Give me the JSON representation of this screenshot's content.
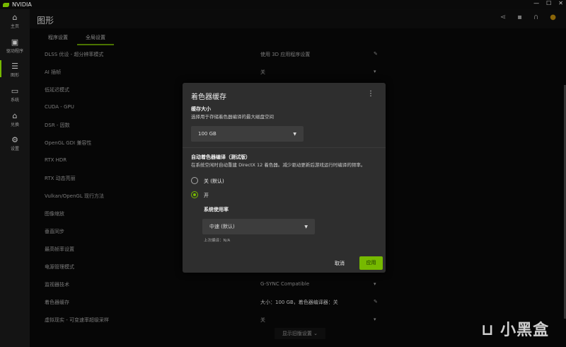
{
  "app": {
    "title": "NVIDIA",
    "window_controls": [
      "minimize",
      "maximize",
      "close"
    ]
  },
  "sidebar": {
    "items": [
      {
        "label": "主页",
        "icon": "home-icon"
      },
      {
        "label": "驱动程序",
        "icon": "driver-icon"
      },
      {
        "label": "图形",
        "icon": "sliders-icon",
        "active": true
      },
      {
        "label": "系统",
        "icon": "system-icon"
      },
      {
        "label": "兑换",
        "icon": "gift-icon"
      },
      {
        "label": "设置",
        "icon": "gear-icon"
      }
    ]
  },
  "header": {
    "title": "图形",
    "icons": [
      "share-icon",
      "feedback-icon",
      "headset-icon",
      "avatar"
    ]
  },
  "tabs": [
    {
      "label": "程序设置"
    },
    {
      "label": "全局设置",
      "active": true
    }
  ],
  "settings": [
    {
      "label": "DLSS 优设 - 超分辨率模式",
      "value": "使用 3D 应用程序设置",
      "control": "edit"
    },
    {
      "label": "AI 插帧",
      "value": "关",
      "control": "dropdown"
    },
    {
      "label": "低延迟模式"
    },
    {
      "label": "CUDA - GPU"
    },
    {
      "label": "DSR - 因数"
    },
    {
      "label": "OpenGL GDI 兼容性"
    },
    {
      "label": "RTX HDR"
    },
    {
      "label": "RTX 动态亮丽"
    },
    {
      "label": "Vulkan/OpenGL 现行方法"
    },
    {
      "label": "图像缩放"
    },
    {
      "label": "垂直同步"
    },
    {
      "label": "最高帧率设置"
    },
    {
      "label": "电源管理模式"
    },
    {
      "label": "监视器技术",
      "value": "G-SYNC Compatible",
      "control": "dropdown"
    },
    {
      "label": "着色器缓存",
      "value": "大小：100 GB，着色器编译器：关",
      "control": "edit"
    },
    {
      "label": "虚拟现实 - 可变速率超级采样",
      "value": "关",
      "control": "dropdown"
    }
  ],
  "show_legacy": "显示旧版设置",
  "dialog": {
    "title": "着色器缓存",
    "cache_size": {
      "heading": "缓存大小",
      "desc": "选择用于存储着色器编译的最大磁盘空间",
      "value": "100 GB"
    },
    "auto_compile": {
      "heading": "自动着色器编译（测试版）",
      "desc": "在系统空闲时自动重建 DirectX 12 着色器。减少驱动更新后游戏运行时编译的频率。",
      "options": [
        {
          "label": "关 (默认)",
          "selected": false
        },
        {
          "label": "开",
          "selected": true
        }
      ],
      "usage_label": "系统使用率",
      "usage_value": "中速 (默认)",
      "last_compile": "上次编译：N/A"
    },
    "cancel": "取消",
    "apply": "应用"
  },
  "watermark": "小黑盒",
  "colors": {
    "accent": "#76b900",
    "dialog_bg": "#2e2e2e"
  }
}
